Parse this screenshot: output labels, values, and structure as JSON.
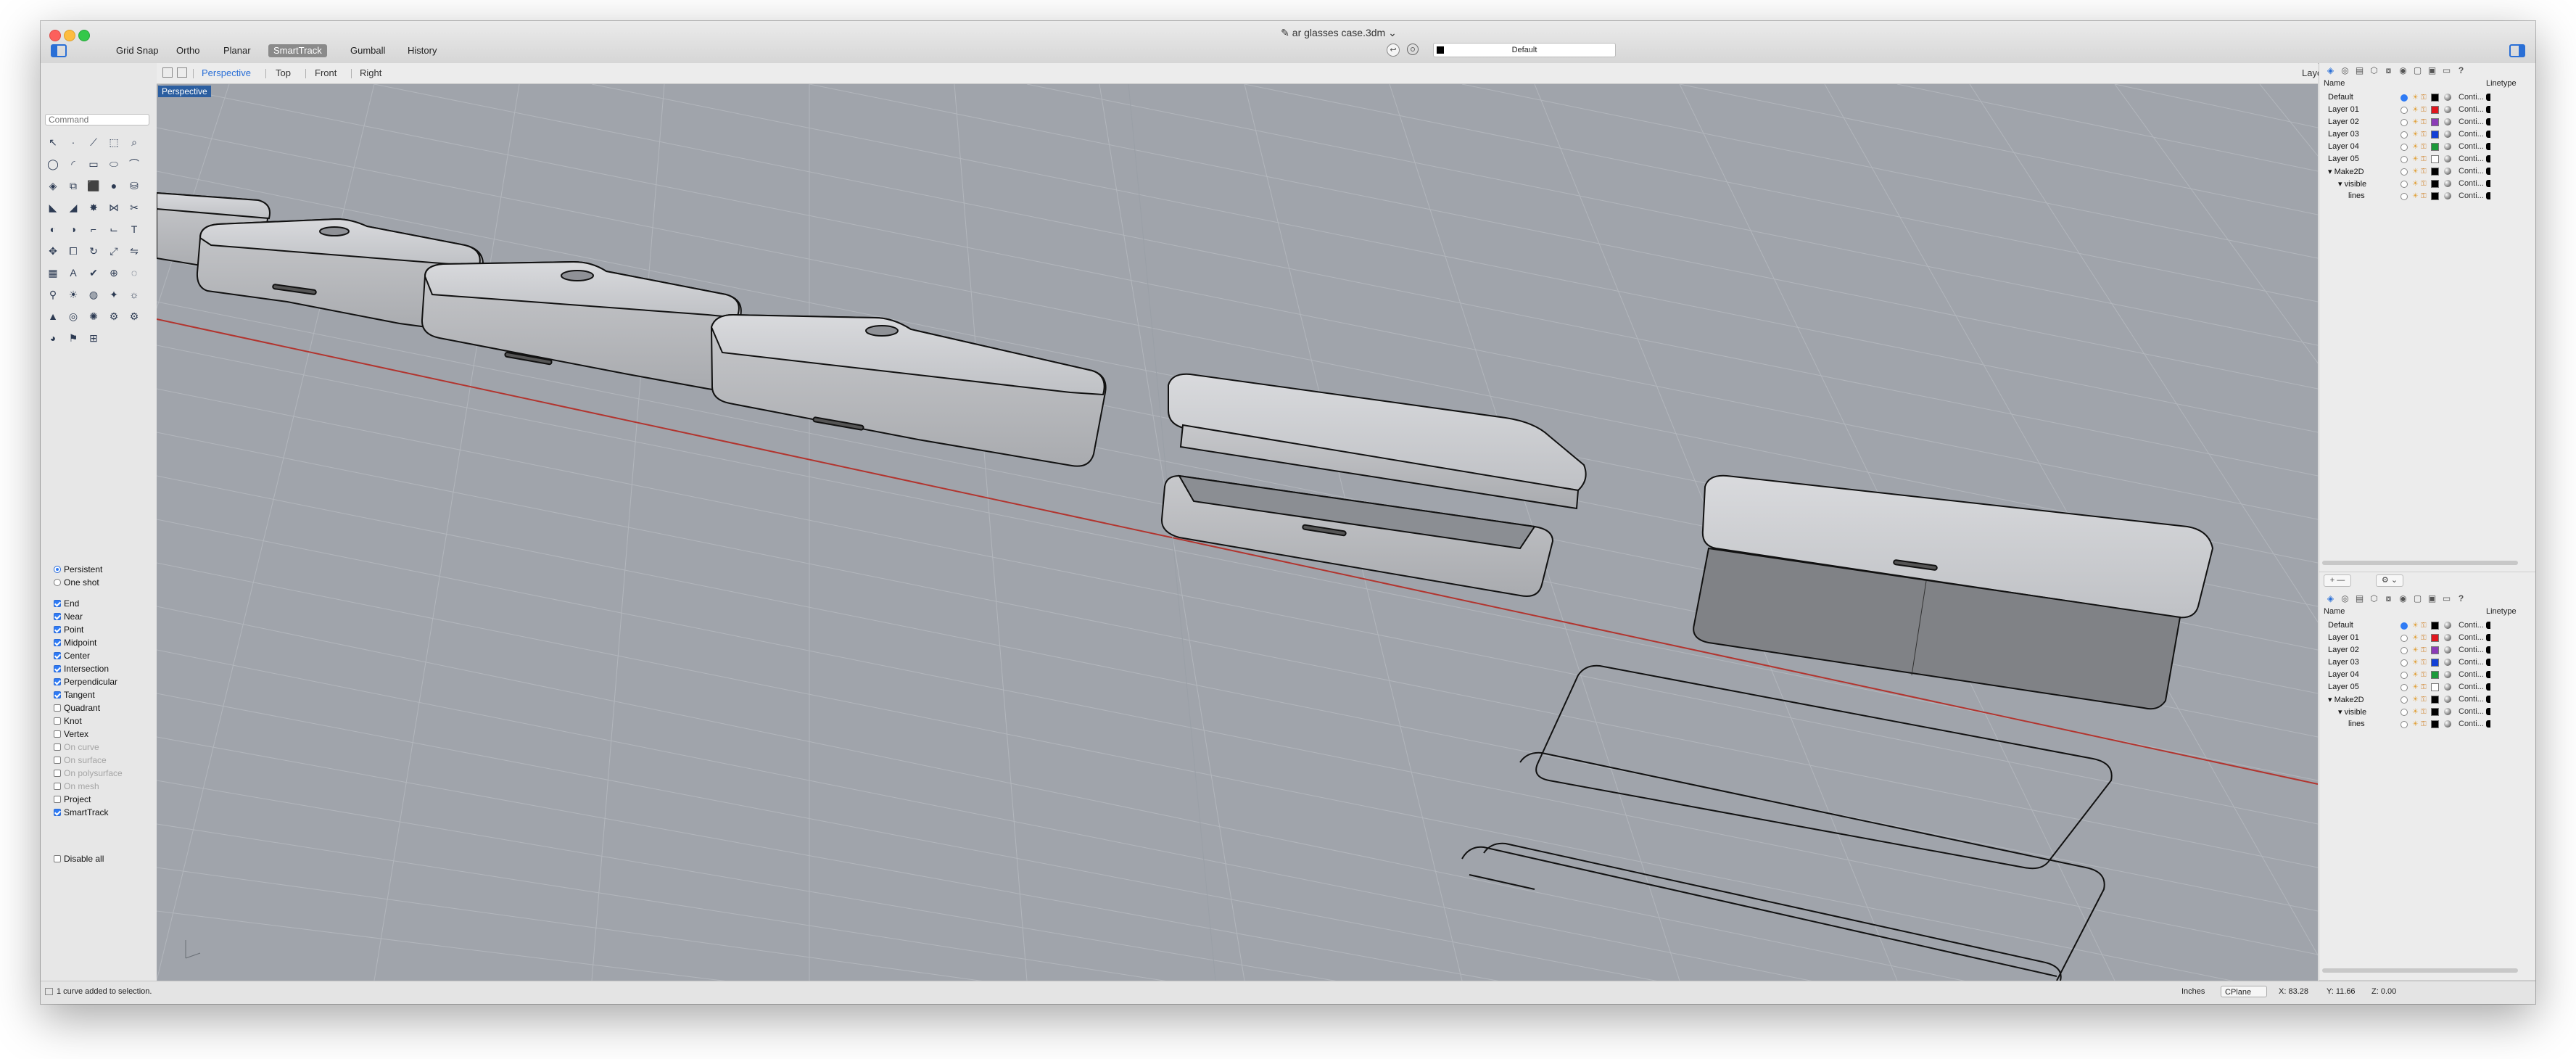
{
  "window": {
    "title": "ar glasses case.3dm",
    "title_prefix": "✎",
    "title_suffix": "⌄"
  },
  "toolbar": {
    "modes": [
      "Grid Snap",
      "Ortho",
      "Planar",
      "SmartTrack",
      "Gumball",
      "History"
    ],
    "active_mode": "SmartTrack",
    "current_layer": "Default"
  },
  "command": {
    "placeholder": "Command"
  },
  "viewport_tabs": {
    "tabs": [
      "Perspective",
      "Top",
      "Front",
      "Right"
    ],
    "active": "Perspective",
    "layouts": "Layouts..."
  },
  "viewport": {
    "label": "Perspective"
  },
  "osnap": {
    "modes": [
      {
        "label": "Persistent",
        "type": "radio",
        "on": true
      },
      {
        "label": "One shot",
        "type": "radio",
        "on": false
      }
    ],
    "snaps": [
      {
        "label": "End",
        "on": true
      },
      {
        "label": "Near",
        "on": true
      },
      {
        "label": "Point",
        "on": true
      },
      {
        "label": "Midpoint",
        "on": true
      },
      {
        "label": "Center",
        "on": true
      },
      {
        "label": "Intersection",
        "on": true
      },
      {
        "label": "Perpendicular",
        "on": true
      },
      {
        "label": "Tangent",
        "on": true
      },
      {
        "label": "Quadrant",
        "on": false
      },
      {
        "label": "Knot",
        "on": false
      },
      {
        "label": "Vertex",
        "on": false
      },
      {
        "label": "On curve",
        "on": false,
        "dim": true
      },
      {
        "label": "On surface",
        "on": false,
        "dim": true
      },
      {
        "label": "On polysurface",
        "on": false,
        "dim": true
      },
      {
        "label": "On mesh",
        "on": false,
        "dim": true
      },
      {
        "label": "Project",
        "on": false
      },
      {
        "label": "SmartTrack",
        "on": true
      }
    ],
    "disable_all": "Disable all"
  },
  "layers": {
    "header_name": "Name",
    "header_linetype": "Linetype",
    "rows": [
      {
        "name": "Default",
        "indent": 0,
        "current": true,
        "color": "#000000",
        "linetype": "Conti..."
      },
      {
        "name": "Layer 01",
        "indent": 0,
        "current": false,
        "color": "#e0161e",
        "linetype": "Conti..."
      },
      {
        "name": "Layer 02",
        "indent": 0,
        "current": false,
        "color": "#8b3bb7",
        "linetype": "Conti..."
      },
      {
        "name": "Layer 03",
        "indent": 0,
        "current": false,
        "color": "#1340d6",
        "linetype": "Conti..."
      },
      {
        "name": "Layer 04",
        "indent": 0,
        "current": false,
        "color": "#1c9a3a",
        "linetype": "Conti..."
      },
      {
        "name": "Layer 05",
        "indent": 0,
        "current": false,
        "color": "#ffffff",
        "linetype": "Conti..."
      },
      {
        "name": "▾ Make2D",
        "indent": 0,
        "current": false,
        "color": "#000000",
        "linetype": "Conti..."
      },
      {
        "name": "▾ visible",
        "indent": 1,
        "current": false,
        "color": "#000000",
        "linetype": "Conti..."
      },
      {
        "name": "lines",
        "indent": 2,
        "current": false,
        "color": "#000000",
        "linetype": "Conti..."
      }
    ]
  },
  "status": {
    "message": "1 curve added to selection.",
    "units": "Inches",
    "cplane": "CPlane",
    "x": "X: 83.28",
    "y": "Y: 11.66",
    "z": "Z: 0.00"
  },
  "colors": {
    "viewport_bg": "#a0a4ab",
    "grid": "#b1b5bb",
    "x_axis": "#b2342e",
    "accent": "#2a6fd6"
  }
}
